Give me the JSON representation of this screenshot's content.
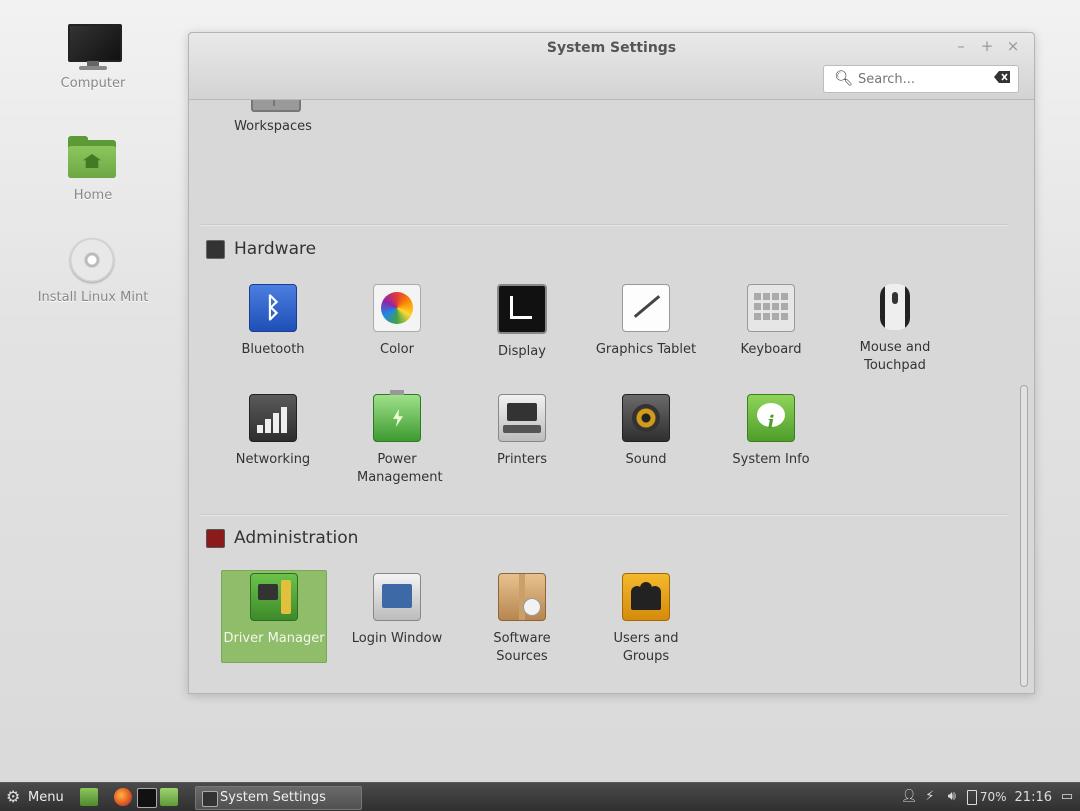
{
  "desktop": {
    "icons": [
      {
        "label": "Computer"
      },
      {
        "label": "Home"
      },
      {
        "label": "Install Linux Mint"
      }
    ]
  },
  "window": {
    "title": "System Settings",
    "controls": {
      "minimize": "–",
      "maximize": "+",
      "close": "×"
    },
    "search": {
      "placeholder": "Search..."
    }
  },
  "sections": {
    "top_item": {
      "label": "Workspaces"
    },
    "hardware": {
      "title": "Hardware",
      "items": [
        {
          "label": "Bluetooth"
        },
        {
          "label": "Color"
        },
        {
          "label": "Display"
        },
        {
          "label": "Graphics Tablet"
        },
        {
          "label": "Keyboard"
        },
        {
          "label": "Mouse and Touchpad"
        },
        {
          "label": "Networking"
        },
        {
          "label": "Power Management"
        },
        {
          "label": "Printers"
        },
        {
          "label": "Sound"
        },
        {
          "label": "System Info"
        }
      ]
    },
    "administration": {
      "title": "Administration",
      "items": [
        {
          "label": "Driver Manager",
          "selected": true
        },
        {
          "label": "Login Window"
        },
        {
          "label": "Software Sources"
        },
        {
          "label": "Users and Groups"
        }
      ]
    }
  },
  "taskbar": {
    "menu_label": "Menu",
    "task_label": "System Settings",
    "battery": "70%",
    "clock": "21:16"
  },
  "colors": {
    "selection": "#8fbd69",
    "accent_green": "#6ba744",
    "taskbar": "#3a3a3a"
  }
}
